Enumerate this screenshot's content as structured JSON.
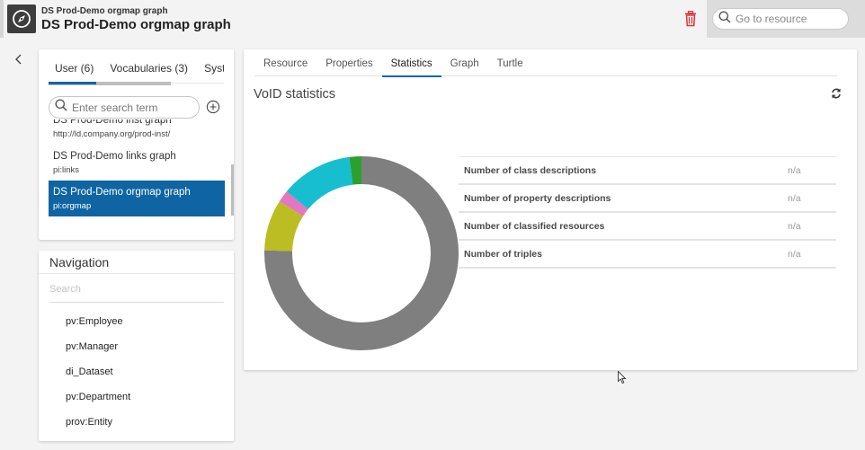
{
  "header": {
    "app_icon": "compass-icon",
    "subtitle": "DS Prod-Demo orgmap graph",
    "title": "DS Prod-Demo orgmap graph",
    "delete_icon": "trash-icon",
    "goto_search": {
      "placeholder": "Go to resource",
      "value": ""
    }
  },
  "sidebar": {
    "collapse_icon": "chevron-left-icon",
    "tabs": [
      {
        "label": "User (6)",
        "active": true
      },
      {
        "label": "Vocabularies (3)",
        "active": false
      },
      {
        "label": "Syster",
        "active": false
      }
    ],
    "search": {
      "placeholder": "Enter search term",
      "value": ""
    },
    "add_icon": "plus-circle-icon",
    "graphs": [
      {
        "name": "DS Prod-Demo inst graph",
        "uri": "http://ld.company.org/prod-inst/",
        "selected": false
      },
      {
        "name": "DS Prod-Demo links graph",
        "uri": "pi:links",
        "selected": false
      },
      {
        "name": "DS Prod-Demo orgmap graph",
        "uri": "pi:orgmap",
        "selected": true
      }
    ]
  },
  "navigation": {
    "title": "Navigation",
    "search_placeholder": "Search",
    "items": [
      "pv:Employee",
      "pv:Manager",
      "di_Dataset",
      "pv:Department",
      "prov:Entity"
    ]
  },
  "main": {
    "tabs": [
      {
        "label": "Resource",
        "active": false
      },
      {
        "label": "Properties",
        "active": false
      },
      {
        "label": "Statistics",
        "active": true
      },
      {
        "label": "Graph",
        "active": false
      },
      {
        "label": "Turtle",
        "active": false
      }
    ],
    "section_title": "VoID statistics",
    "refresh_icon": "refresh-icon",
    "stats": [
      {
        "label": "Number of class descriptions",
        "value": "n/a"
      },
      {
        "label": "Number of property descriptions",
        "value": "n/a"
      },
      {
        "label": "Number of classified resources",
        "value": "n/a"
      },
      {
        "label": "Number of triples",
        "value": "n/a"
      }
    ]
  },
  "chart_data": {
    "type": "pie",
    "variant": "donut",
    "title": "",
    "legend": "none",
    "slices": [
      {
        "label": "",
        "value": 75.5,
        "color": "#7f7f7f"
      },
      {
        "label": "",
        "value": 8.5,
        "color": "#bcbd22"
      },
      {
        "label": "",
        "value": 2,
        "color": "#e377c2"
      },
      {
        "label": "",
        "value": 12,
        "color": "#17becf"
      },
      {
        "label": "",
        "value": 2,
        "color": "#2ca02c"
      }
    ]
  },
  "colors": {
    "accent": "#1565a5",
    "selected_bg": "#0f65a3",
    "delete": "#d9363e"
  }
}
